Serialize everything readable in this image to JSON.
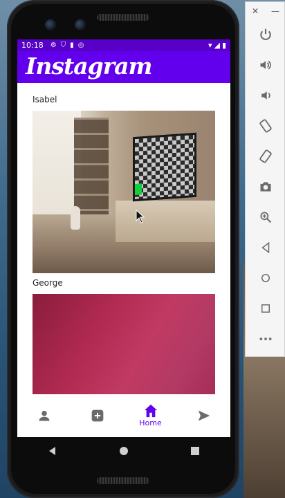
{
  "status_bar": {
    "time": "10:18"
  },
  "app": {
    "title": "Instagram"
  },
  "feed": {
    "posts": [
      {
        "username": "Isabel"
      },
      {
        "username": "George"
      }
    ]
  },
  "bottom_nav": {
    "items": [
      {
        "icon": "person-icon",
        "label": ""
      },
      {
        "icon": "add-box-icon",
        "label": ""
      },
      {
        "icon": "home-icon",
        "label": "Home",
        "active": true
      },
      {
        "icon": "send-icon",
        "label": ""
      }
    ]
  },
  "emulator_toolbar": {
    "header": [
      "close",
      "minimize"
    ],
    "buttons": [
      "power-icon",
      "volume-up-icon",
      "volume-down-icon",
      "rotate-left-icon",
      "rotate-right-icon",
      "camera-icon",
      "zoom-icon",
      "back-icon",
      "home-circle-icon",
      "overview-square-icon",
      "more-icon"
    ]
  },
  "colors": {
    "status_bar": "#5700c8",
    "app_bar": "#6200ee",
    "accent": "#6200ee"
  }
}
